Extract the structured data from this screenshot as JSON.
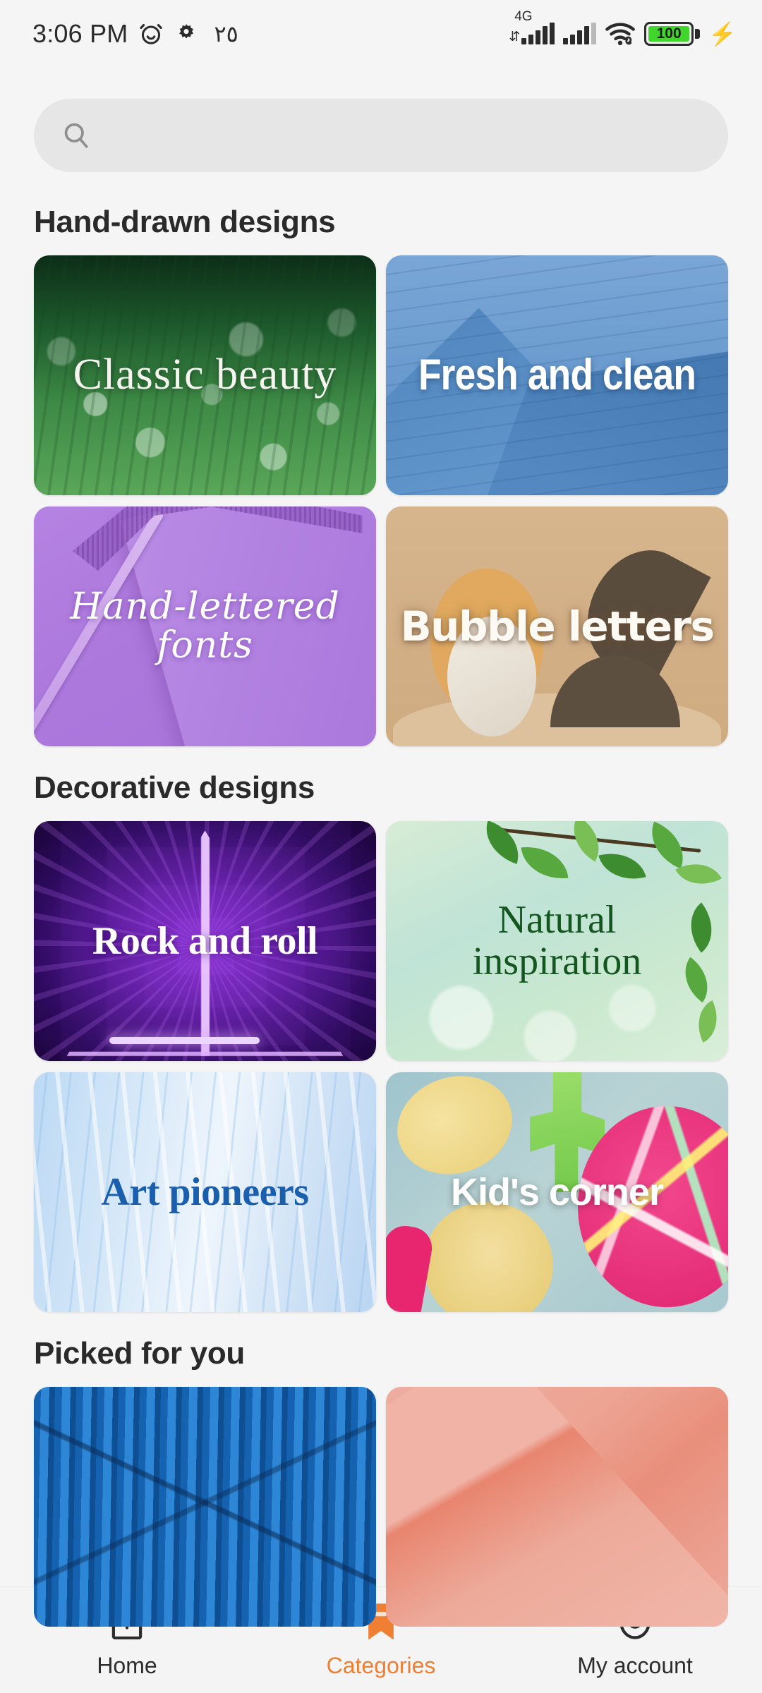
{
  "status_bar": {
    "time": "3:06 PM",
    "alarm_icon": "alarm-clock-icon",
    "settings_icon": "gear-icon",
    "arabic_indicator": "٢٥",
    "network_label": "4G",
    "data_arrows": "⇵",
    "wifi_icon": "wifi-icon",
    "wifi_link_icon": "link-icon",
    "battery_percent": "100",
    "battery_color": "#41d62b",
    "charging_icon": "⚡"
  },
  "search": {
    "placeholder": "",
    "icon": "search-icon"
  },
  "sections": [
    {
      "title": "Hand-drawn designs",
      "cards": [
        {
          "label": "Classic beauty",
          "art": "a-meadow",
          "style": "t-serif-white"
        },
        {
          "label": "Fresh and clean",
          "art": "a-archblue",
          "style": "t-cond-white"
        },
        {
          "label": "Hand-lettered fonts",
          "art": "a-purple",
          "style": "t-script-white"
        },
        {
          "label": "Bubble letters",
          "art": "a-tan",
          "style": "t-bubble-white"
        }
      ]
    },
    {
      "title": "Decorative designs",
      "cards": [
        {
          "label": "Rock and roll",
          "art": "a-neon",
          "style": "t-slab-white"
        },
        {
          "label": "Natural inspiration",
          "art": "a-leafy",
          "style": "t-serif-green"
        },
        {
          "label": "Art pioneers",
          "art": "a-silk",
          "style": "t-serif-blue"
        },
        {
          "label": "Kid's corner",
          "art": "a-candy",
          "style": "t-sans-white-bold"
        }
      ]
    },
    {
      "title": "Picked for you",
      "cards": [
        {
          "label": "",
          "art": "a-bluestripe",
          "style": "t-sans-white-bold"
        },
        {
          "label": "",
          "art": "a-salmon",
          "style": "t-sans-white-bold"
        }
      ]
    }
  ],
  "section_titles": {
    "hand_drawn": "Hand-drawn designs",
    "decorative": "Decorative designs",
    "picked": "Picked for you"
  },
  "cards": {
    "classic_beauty": "Classic beauty",
    "fresh_and_clean": "Fresh and clean",
    "hand_lettered_fonts": "Hand-lettered fonts",
    "bubble_letters": "Bubble letters",
    "rock_and_roll": "Rock and roll",
    "natural_inspiration_line1": "Natural",
    "natural_inspiration_line2": "inspiration",
    "art_pioneers": "Art pioneers",
    "kids_corner": "Kid's corner"
  },
  "bottom_nav": {
    "active": "Categories",
    "accent_color": "#ef7f33",
    "items": [
      {
        "label": "Home",
        "icon": "home-icon",
        "active": false
      },
      {
        "label": "Categories",
        "icon": "bookmark-icon",
        "active": true
      },
      {
        "label": "My account",
        "icon": "smiley-icon",
        "active": false
      }
    ]
  }
}
